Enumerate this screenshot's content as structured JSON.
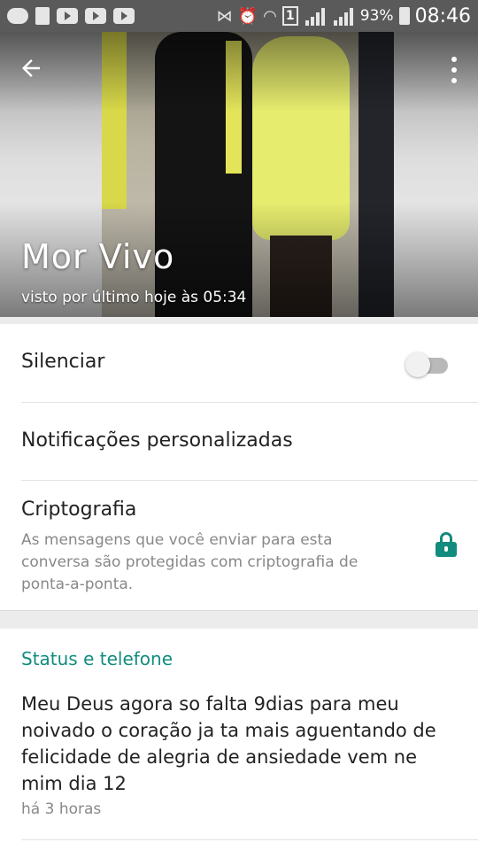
{
  "status_bar": {
    "battery_percent": "93%",
    "time": "08:46",
    "sim_slot": "1"
  },
  "header": {
    "contact_name": "Mor Vivo",
    "last_seen": "visto por último hoje às 05:34",
    "back_icon": "arrow-back-icon",
    "menu_icon": "more-vert-icon"
  },
  "settings": {
    "mute_label": "Silenciar",
    "mute_enabled": false,
    "custom_notifications_label": "Notificações personalizadas",
    "encryption_label": "Criptografia",
    "encryption_description": "As mensagens que você enviar para esta conversa são protegidas com criptografia de ponta-a-ponta.",
    "lock_icon": "lock-icon"
  },
  "status_section": {
    "title": "Status e telefone",
    "status_text": "Meu Deus agora so falta 9dias para meu noivado o coração ja ta mais aguentando de felicidade de alegria de ansiedade vem ne mim dia 12",
    "status_time": "há 3 horas"
  },
  "colors": {
    "accent": "#128c7e",
    "status_bar": "#5a5a5a"
  }
}
